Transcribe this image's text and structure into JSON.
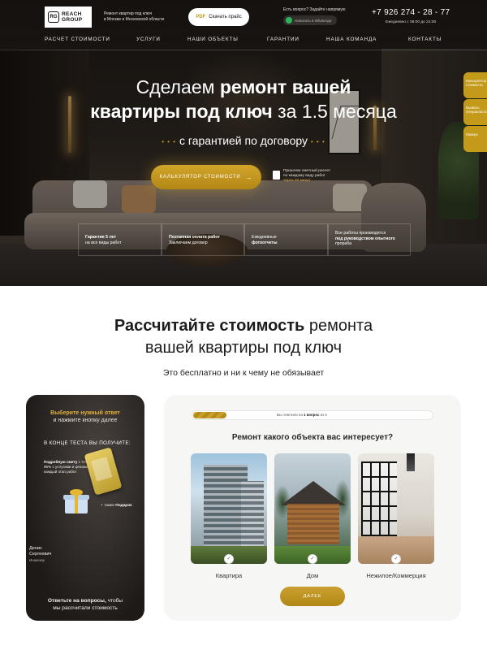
{
  "header": {
    "logo_mark": "RG",
    "logo_name_line1": "REACH",
    "logo_name_line2": "GROUP",
    "tagline_line1": "Ремонт квартир под ключ",
    "tagline_line2": "в Москве и Московской области",
    "pdf_badge": "PDF",
    "download_price": "Скачать прайс",
    "ask_text": "Есть вопрос? Задайте напрямую",
    "whatsapp_label": "Написать в WhatsApp",
    "phone": "+7 926 274 - 28 - 77",
    "hours": "Ежедневно с 08:00 до 22:00"
  },
  "nav": [
    "РАСЧЕТ СТОИМОСТИ",
    "УСЛУГИ",
    "НАШИ ОБЪЕКТЫ",
    "ГАРАНТИИ",
    "НАША КОМАНДА",
    "КОНТАКТЫ"
  ],
  "side_tabs": [
    [
      "Калькулятор",
      "стоимости"
    ],
    [
      "Вызвать",
      "специалиста"
    ],
    [
      "Наверх",
      ""
    ]
  ],
  "hero": {
    "headline_pre": "Сделаем ",
    "headline_bold1": "ремонт вашей",
    "headline_bold2": "квартиры под ключ",
    "headline_post": " за 1.5 месяца",
    "guarantee": "с гарантией по договору",
    "dots": "• • •",
    "calc_button": "КАЛЬКУЛЯТОР СТОИМОСТИ",
    "calc_arrow": "→",
    "estimate_line1": "Пришлем сметный расчет",
    "estimate_line2": "по каждому виду работ",
    "estimate_line3": "через 30 минут",
    "features": [
      {
        "bold": "Гарантия 5 лет",
        "text": "на все виды работ"
      },
      {
        "bold": "Поэтапная оплата работ",
        "text": "Заключаем договор"
      },
      {
        "bold": "Ежедневные",
        "text": "фотоотчеты"
      },
      {
        "bold": "под руководством опытного",
        "pre": "Все работы производятся",
        "text": "прораба"
      }
    ]
  },
  "calc_section": {
    "title_bold": "Рассчитайте стоимость",
    "title_rest1": " ремонта",
    "title_line2": "вашей квартиры под ключ",
    "subtitle": "Это бесплатно и ни к чему не обязывает"
  },
  "dark_card": {
    "title_line1": "Выберите нужный ответ",
    "title_line2": "и нажмите кнопку далее",
    "get_heading": "В КОНЦЕ ТЕСТА ВЫ ПОЛУЧИТЕ:",
    "item1_bold": "Подробную смету",
    "item1_rest": "с точностью 95% с услугами и ценами на каждый этап работ",
    "gift_prefix": "+ также ",
    "gift_bold": "Подарок",
    "person_name_line1": "Денис",
    "person_name_line2": "Сергеевич",
    "person_role": "Инженер",
    "footer_bold": "Ответьте на вопросы,",
    "footer_rest": " чтобы",
    "footer_line2": "мы рассчитали стоимость"
  },
  "quiz": {
    "progress_prefix": "Вы ответили на ",
    "progress_bold": "1 вопрос",
    "progress_suffix": " из 6",
    "progress_fraction": 0.14,
    "question": "Ремонт какого объекта вас интересует?",
    "options": [
      "Квартира",
      "Дом",
      "Нежилое/Коммерция"
    ],
    "check": "✓",
    "next_button": "ДАЛЕЕ"
  },
  "colors": {
    "accent": "#c39a1a",
    "hero_dark": "#2a241f",
    "card_bg": "#f6f6f5"
  }
}
